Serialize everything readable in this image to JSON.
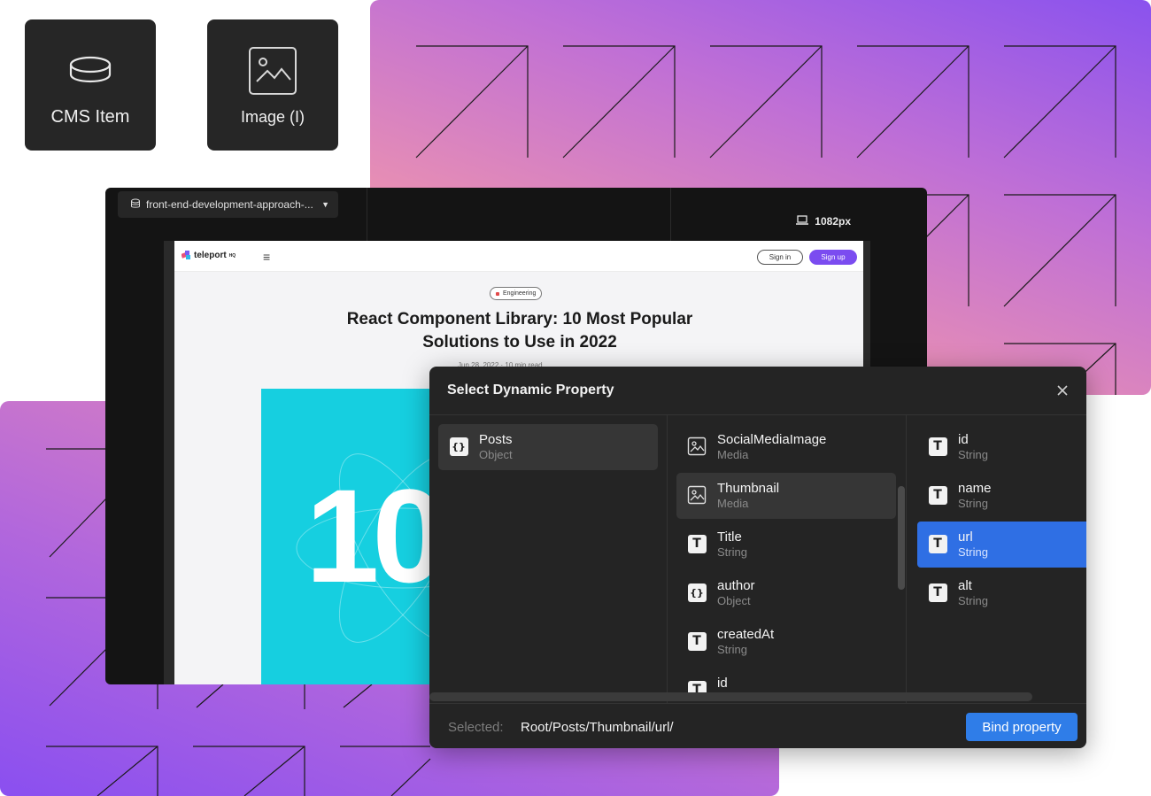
{
  "tiles": {
    "cms_item": {
      "label": "CMS Item",
      "icon": "database-icon"
    },
    "image": {
      "label": "Image (I)",
      "icon": "image-icon"
    }
  },
  "editor": {
    "page_selector": {
      "label": "front-end-development-approach-...",
      "icon": "database-icon"
    },
    "viewport": {
      "label": "1082px",
      "icon": "laptop-icon"
    }
  },
  "preview": {
    "logo_text": "teleport",
    "logo_suffix": "HQ",
    "menu_icon": "≡",
    "signin_label": "Sign in",
    "signup_label": "Sign up",
    "category": "Engineering",
    "title": "React Component Library: 10 Most Popular Solutions to Use in 2022",
    "meta": "Jun 28, 2022  ·  10 min read",
    "hero_number": "10",
    "hero_color": "#16cfe0"
  },
  "dialog": {
    "title": "Select Dynamic Property",
    "close_icon": "close-icon",
    "columns": [
      {
        "items": [
          {
            "name": "Posts",
            "type": "Object",
            "icon": "object-icon",
            "state": "highlighted"
          }
        ]
      },
      {
        "items": [
          {
            "name": "SocialMediaImage",
            "type": "Media",
            "icon": "image-icon",
            "state": ""
          },
          {
            "name": "Thumbnail",
            "type": "Media",
            "icon": "image-icon",
            "state": "highlighted"
          },
          {
            "name": "Title",
            "type": "String",
            "icon": "text-icon",
            "state": ""
          },
          {
            "name": "author",
            "type": "Object",
            "icon": "object-icon",
            "state": ""
          },
          {
            "name": "createdAt",
            "type": "String",
            "icon": "text-icon",
            "state": ""
          },
          {
            "name": "id",
            "type": "",
            "icon": "text-icon",
            "state": ""
          }
        ]
      },
      {
        "items": [
          {
            "name": "id",
            "type": "String",
            "icon": "text-icon",
            "state": ""
          },
          {
            "name": "name",
            "type": "String",
            "icon": "text-icon",
            "state": ""
          },
          {
            "name": "url",
            "type": "String",
            "icon": "text-icon",
            "state": "selected"
          },
          {
            "name": "alt",
            "type": "String",
            "icon": "text-icon",
            "state": ""
          }
        ]
      }
    ],
    "footer": {
      "selected_label": "Selected:",
      "selected_path": "Root/Posts/Thumbnail/url/",
      "bind_label": "Bind property"
    }
  },
  "colors": {
    "accent_blue": "#2f7de8",
    "selected_row": "#2f6fe4",
    "signup_purple": "#7b4cf0",
    "gradient_purple": "#8a52ee",
    "gradient_pink": "#f5a3a8"
  }
}
